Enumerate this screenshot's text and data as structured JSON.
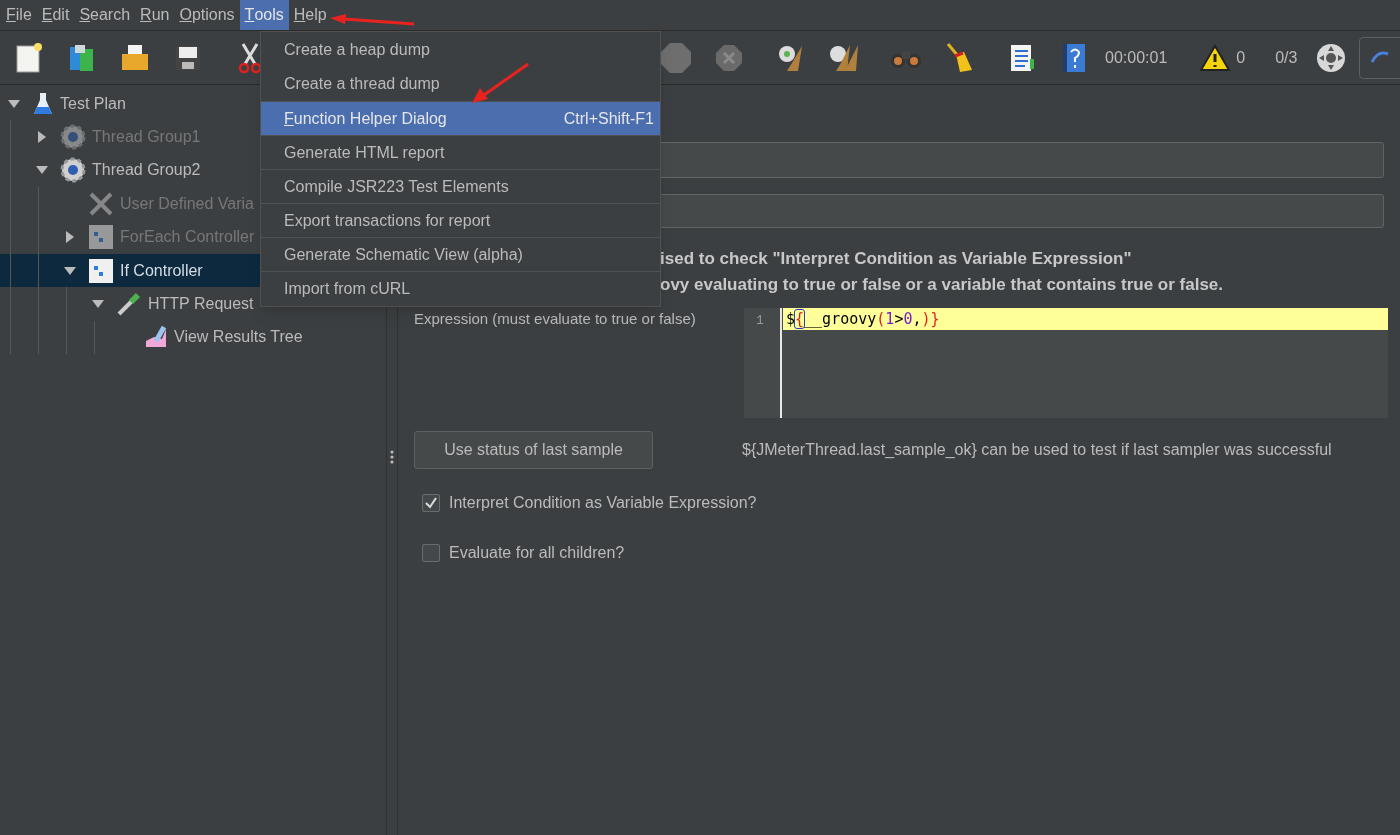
{
  "menu_bar": [
    {
      "label": "File",
      "selected": false
    },
    {
      "label": "Edit",
      "selected": false
    },
    {
      "label": "Search",
      "selected": false
    },
    {
      "label": "Run",
      "selected": false
    },
    {
      "label": "Options",
      "selected": false
    },
    {
      "label": "Tools",
      "selected": true
    },
    {
      "label": "Help",
      "selected": false
    }
  ],
  "tools_menu": [
    {
      "label": "Create a heap dump",
      "selected": false
    },
    {
      "label": "Create a thread dump",
      "selected": false
    },
    {
      "label": "Function Helper Dialog",
      "shortcut": "Ctrl+Shift-F1",
      "selected": true
    },
    {
      "label": "Generate HTML report",
      "selected": false
    },
    {
      "label": "Compile JSR223 Test Elements",
      "selected": false
    },
    {
      "label": "Export transactions for report",
      "selected": false
    },
    {
      "label": "Generate Schematic View (alpha)",
      "selected": false
    },
    {
      "label": "Import from cURL",
      "selected": false
    }
  ],
  "toolbar": {
    "elapsed_time": "00:00:01",
    "warning_count": "0",
    "active_threads": "0/3"
  },
  "tree": [
    {
      "label": "Test Plan",
      "kind": "plan",
      "disabled": false,
      "expanded": true,
      "selected": false,
      "children": [
        {
          "label": "Thread Group1",
          "kind": "thread-group",
          "disabled": true,
          "expanded": false,
          "selected": false
        },
        {
          "label": "Thread Group2",
          "kind": "thread-group",
          "disabled": false,
          "expanded": true,
          "selected": false,
          "children": [
            {
              "label": "User Defined Varia",
              "kind": "config",
              "disabled": true,
              "selected": false
            },
            {
              "label": "ForEach Controller",
              "kind": "controller",
              "disabled": true,
              "expanded": false,
              "selected": false
            },
            {
              "label": "If Controller",
              "kind": "controller",
              "disabled": false,
              "expanded": true,
              "selected": true,
              "children": [
                {
                  "label": "HTTP Request",
                  "kind": "sampler",
                  "disabled": false,
                  "expanded": true,
                  "selected": false,
                  "children": [
                    {
                      "label": "View Results Tree",
                      "kind": "listener",
                      "disabled": false,
                      "selected": false
                    }
                  ]
                }
              ]
            }
          ]
        }
      ]
    }
  ],
  "editor": {
    "info_lines": [
      "ised to check \"Interpret Condition as Variable Expression\"",
      "ovy evaluating to true or false or a variable that contains true or false."
    ],
    "expression_label": "Expression (must evaluate to true or false)",
    "line_number": "1",
    "code_tokens": [
      {
        "text": "$",
        "kind": "plain"
      },
      {
        "text": "{",
        "kind": "matched-brace"
      },
      {
        "text": "__groovy",
        "kind": "plain"
      },
      {
        "text": "(",
        "kind": "brace"
      },
      {
        "text": "1",
        "kind": "number"
      },
      {
        "text": ">",
        "kind": "plain"
      },
      {
        "text": "0",
        "kind": "number"
      },
      {
        "text": ",",
        "kind": "plain"
      },
      {
        "text": ")}",
        "kind": "brace"
      }
    ],
    "last_sample_button": "Use status of last sample",
    "last_sample_hint": "${JMeterThread.last_sample_ok} can be used to test if last sampler was successful",
    "options": [
      {
        "label": "Interpret Condition as Variable Expression?",
        "checked": true
      },
      {
        "label": "Evaluate for all children?",
        "checked": false
      }
    ]
  }
}
